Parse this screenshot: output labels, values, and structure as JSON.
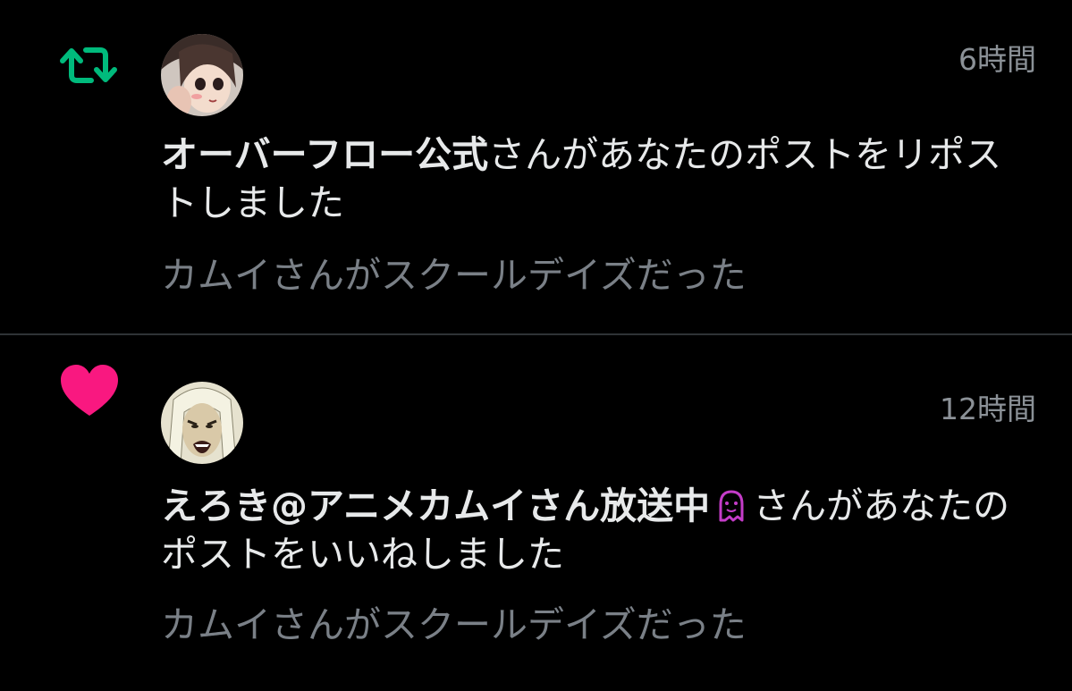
{
  "notifications": [
    {
      "type": "repost",
      "type_icon": "repost-icon",
      "type_color": "#00ba7c",
      "time": "6時間",
      "user_name": "オーバーフロー公式",
      "action_text": "さんがあなたのポストをリポストしました",
      "post_snippet": "カムイさんがスクールデイズだった"
    },
    {
      "type": "like",
      "type_icon": "heart-icon",
      "type_color": "#f91880",
      "time": "12時間",
      "user_name": "えろき@アニメカムイさん放送中",
      "name_emoji": "ghost-emoji",
      "action_text": "さんがあなたのポストをいいねしました",
      "post_snippet": "カムイさんがスクールデイズだった"
    }
  ]
}
